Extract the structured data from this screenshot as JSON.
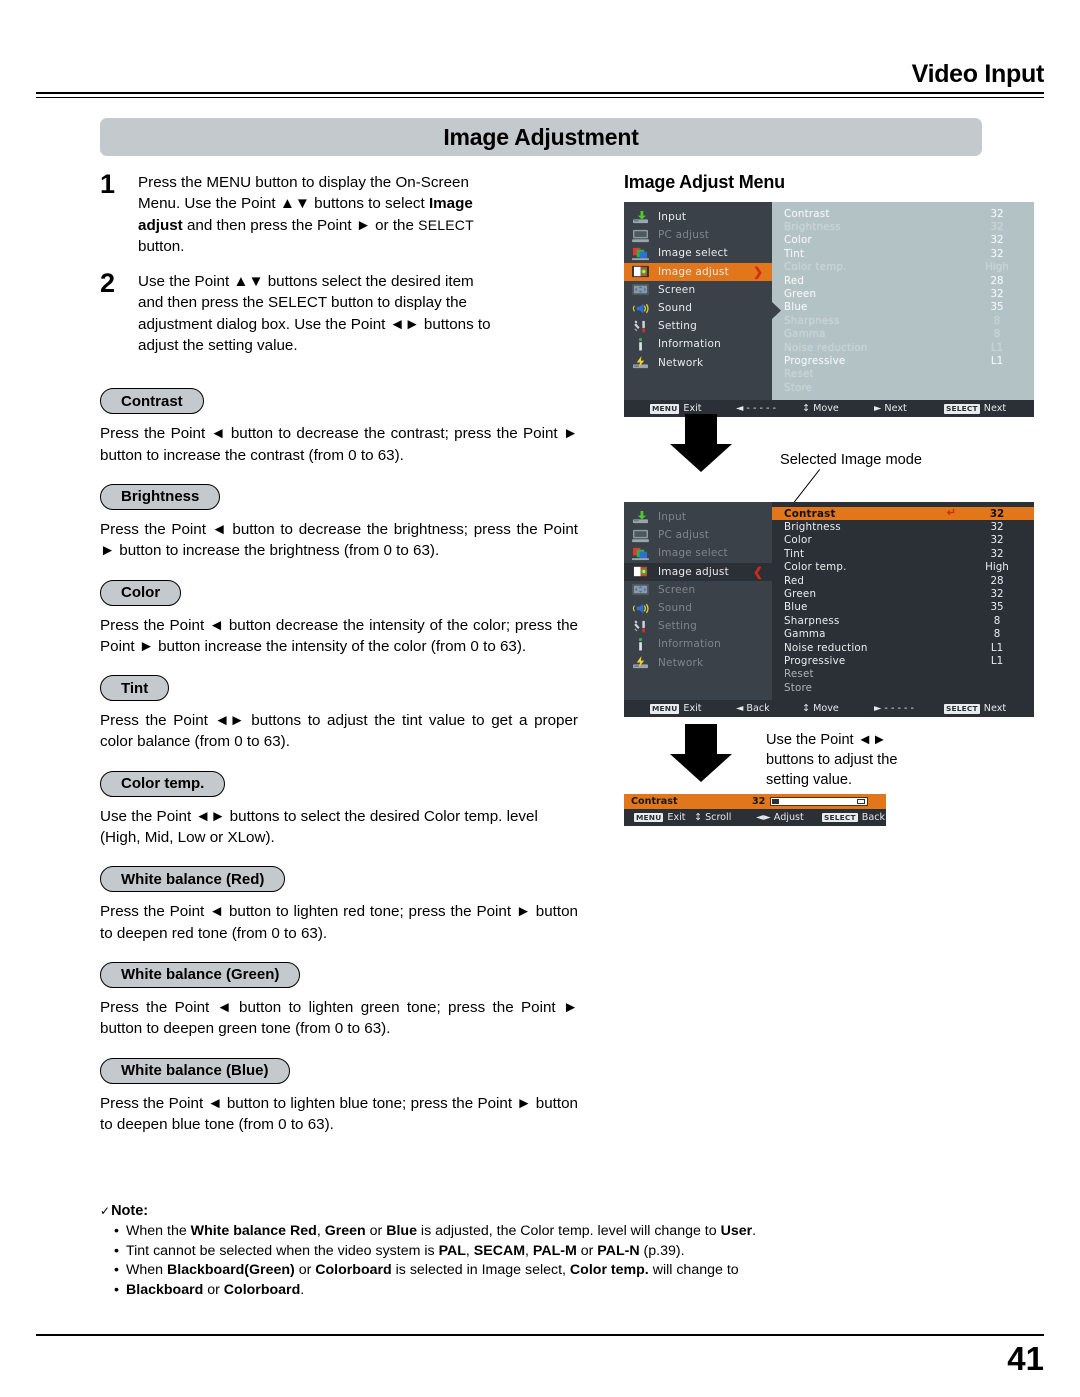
{
  "header": {
    "section_title": "Video Input",
    "banner": "Image Adjustment"
  },
  "footer": {
    "page_number": "41"
  },
  "steps": [
    {
      "num": "1",
      "line1": "Press the MENU button to display the On-Screen",
      "line2a": "Menu. Use the Point ",
      "line2b": "▲▼",
      "line2c": " buttons to select ",
      "line2bold": "Image",
      "line3bold": "adjust",
      "line3a": " and then press the Point ",
      "line3b": "►",
      "line3c": " or the ",
      "line3sc": "SELECT",
      "line4": "button."
    },
    {
      "num": "2",
      "line1a": "Use the Point ",
      "line1b": "▲▼",
      "line1c": " buttons select the desired item",
      "line2": "and then press the SELECT button to display the",
      "line3a": "adjustment dialog box. Use the Point ",
      "line3b": "◄►",
      "line3c": " buttons to",
      "line4": "adjust the setting value."
    }
  ],
  "sections": [
    {
      "pill": "Contrast",
      "body": "Press the Point ◄ button to decrease the contrast; press the Point ► button to increase the contrast (from 0 to 63)."
    },
    {
      "pill": "Brightness",
      "body": "Press the Point ◄ button to decrease the brightness; press the Point ► button to increase the brightness (from 0 to 63)."
    },
    {
      "pill": "Color",
      "body": "Press the Point ◄ button decrease the intensity of the color; press the Point ► button increase the intensity of the color (from 0 to 63)."
    },
    {
      "pill": "Tint",
      "body": "Press the Point ◄► buttons to adjust the tint value to get a proper color balance (from 0 to 63)."
    },
    {
      "pill": "Color temp.",
      "body": "Use the Point ◄► buttons to select the desired Color temp. level (High, Mid, Low or XLow)."
    },
    {
      "pill": "White balance (Red)",
      "body": "Press the Point ◄ button to lighten red tone; press the Point ► button to deepen red tone (from 0 to 63)."
    },
    {
      "pill": "White balance (Green)",
      "body": "Press the Point ◄ button to lighten green tone; press the Point ► button to deepen green tone (from 0 to 63)."
    },
    {
      "pill": "White balance (Blue)",
      "body": "Press the Point ◄ button to lighten blue tone; press the Point ► button to deepen blue tone (from 0 to 63)."
    }
  ],
  "note": {
    "check": "✓",
    "title": "Note:",
    "items": [
      {
        "parts": [
          {
            "t": "When the ",
            "b": false
          },
          {
            "t": "White balance Red",
            "b": true
          },
          {
            "t": ", ",
            "b": false
          },
          {
            "t": "Green",
            "b": true
          },
          {
            "t": " or ",
            "b": false
          },
          {
            "t": "Blue",
            "b": true
          },
          {
            "t": " is adjusted, the Color temp. level will change to ",
            "b": false
          },
          {
            "t": "User",
            "b": true
          },
          {
            "t": ".",
            "b": false
          }
        ]
      },
      {
        "parts": [
          {
            "t": "Tint cannot be selected when the video system is ",
            "b": false
          },
          {
            "t": "PAL",
            "b": true
          },
          {
            "t": ", ",
            "b": false
          },
          {
            "t": "SECAM",
            "b": true
          },
          {
            "t": ", ",
            "b": false
          },
          {
            "t": "PAL-M",
            "b": true
          },
          {
            "t": " or ",
            "b": false
          },
          {
            "t": "PAL-N",
            "b": true
          },
          {
            "t": " (p.39).",
            "b": false
          }
        ]
      },
      {
        "parts": [
          {
            "t": "When ",
            "b": false
          },
          {
            "t": "Blackboard(Green)",
            "b": true
          },
          {
            "t": " or ",
            "b": false
          },
          {
            "t": "Colorboard",
            "b": true
          },
          {
            "t": " is selected in Image select, ",
            "b": false
          },
          {
            "t": "Color temp.",
            "b": true
          },
          {
            "t": " will change to",
            "b": false
          }
        ]
      },
      {
        "parts": [
          {
            "t": "Blackboard",
            "b": true
          },
          {
            "t": " or ",
            "b": false
          },
          {
            "t": "Colorboard",
            "b": true
          },
          {
            "t": ".",
            "b": false
          }
        ]
      }
    ]
  },
  "osd": {
    "heading": "Image Adjust Menu",
    "sidebar": [
      {
        "label": "Input",
        "icon": "input-icon",
        "state": "normal"
      },
      {
        "label": "PC adjust",
        "icon": "pc-adjust-icon",
        "state": "disabled"
      },
      {
        "label": "Image select",
        "icon": "image-select-icon",
        "state": "normal"
      },
      {
        "label": "Image adjust",
        "icon": "image-adjust-icon",
        "state": "selected"
      },
      {
        "label": "Screen",
        "icon": "screen-icon",
        "state": "normal"
      },
      {
        "label": "Sound",
        "icon": "sound-icon",
        "state": "normal"
      },
      {
        "label": "Setting",
        "icon": "setting-icon",
        "state": "normal"
      },
      {
        "label": "Information",
        "icon": "information-icon",
        "state": "normal"
      },
      {
        "label": "Network",
        "icon": "network-icon",
        "state": "normal"
      }
    ],
    "items": [
      {
        "label": "Contrast",
        "value": "32"
      },
      {
        "label": "Brightness",
        "value": "32"
      },
      {
        "label": "Color",
        "value": "32"
      },
      {
        "label": "Tint",
        "value": "32"
      },
      {
        "label": "Color temp.",
        "value": "High"
      },
      {
        "label": "Red",
        "value": "28"
      },
      {
        "label": "Green",
        "value": "32"
      },
      {
        "label": "Blue",
        "value": "35"
      },
      {
        "label": "Sharpness",
        "value": "8"
      },
      {
        "label": "Gamma",
        "value": "8"
      },
      {
        "label": "Noise reduction",
        "value": "L1"
      },
      {
        "label": "Progressive",
        "value": "L1"
      },
      {
        "label": "Reset",
        "value": ""
      },
      {
        "label": "Store",
        "value": ""
      }
    ],
    "menu1_bar": [
      {
        "key": "MENU",
        "label": "Exit"
      },
      {
        "key": "",
        "label": "◄ - - - - -"
      },
      {
        "key": "",
        "label": "↕ Move"
      },
      {
        "key": "",
        "label": "► Next"
      },
      {
        "key": "SELECT",
        "label": "Next"
      }
    ],
    "menu2_bar": [
      {
        "key": "MENU",
        "label": "Exit"
      },
      {
        "key": "",
        "label": "◄ Back"
      },
      {
        "key": "",
        "label": "↕ Move"
      },
      {
        "key": "",
        "label": "► - - - - -"
      },
      {
        "key": "SELECT",
        "label": "Next"
      }
    ],
    "dialog": {
      "title": "Contrast",
      "value": "32",
      "bar": [
        {
          "key": "MENU",
          "label": "Exit"
        },
        {
          "key": "",
          "label": "↕ Scroll"
        },
        {
          "key": "",
          "label": "◄► Adjust"
        },
        {
          "key": "SELECT",
          "label": "Back"
        }
      ]
    },
    "annotations": {
      "selected_image_mode": "Selected Image mode",
      "adjust_hint_l1": "Use the Point ◄►",
      "adjust_hint_l2": "buttons to adjust the",
      "adjust_hint_l3": "setting value."
    }
  },
  "colors": {
    "accent_orange": "#e2761b",
    "panel_dark": "#3b4148",
    "panel_darker": "#2b3036",
    "panel_light": "#b3c2c4",
    "banner_gray": "#c3c9cd",
    "arrow_red": "#d32a12"
  }
}
